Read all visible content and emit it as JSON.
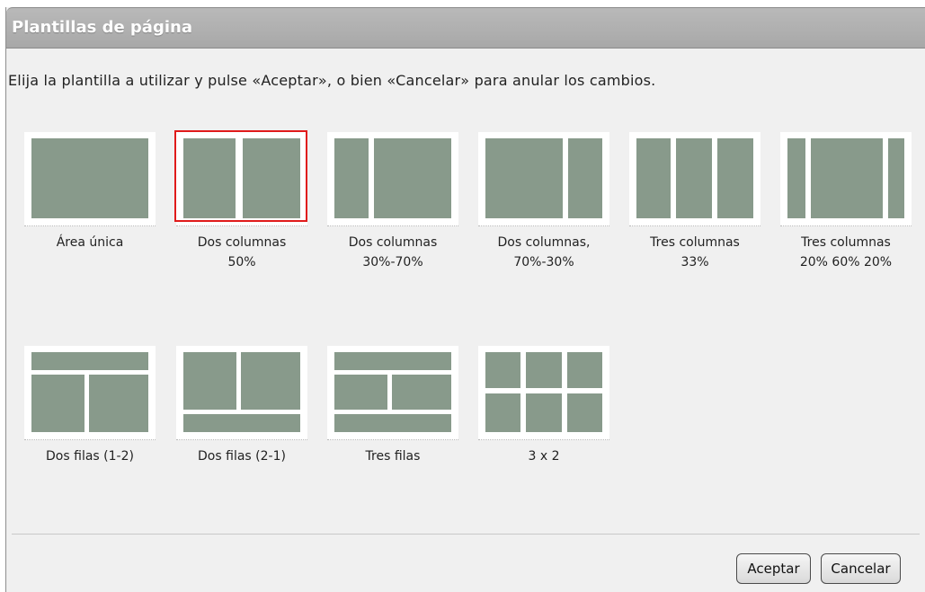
{
  "dialog": {
    "title": "Plantillas de página",
    "instructions": "Elija la plantilla a utilizar y pulse «Aceptar», o bien «Cancelar» para anular los cambios."
  },
  "templates": [
    {
      "id": "area-unica",
      "label": "Área única",
      "selected": false
    },
    {
      "id": "dos-columnas-50",
      "label": "Dos columnas\n50%",
      "selected": true
    },
    {
      "id": "dos-columnas-30-70",
      "label": "Dos columnas\n30%-70%",
      "selected": false
    },
    {
      "id": "dos-columnas-70-30",
      "label": "Dos columnas,\n70%-30%",
      "selected": false
    },
    {
      "id": "tres-columnas-33",
      "label": "Tres columnas\n33%",
      "selected": false
    },
    {
      "id": "tres-columnas-20-60-20",
      "label": "Tres columnas\n20% 60% 20%",
      "selected": false
    },
    {
      "id": "dos-filas-1-2",
      "label": "Dos filas (1-2)",
      "selected": false
    },
    {
      "id": "dos-filas-2-1",
      "label": "Dos filas (2-1)",
      "selected": false
    },
    {
      "id": "tres-filas",
      "label": "Tres filas",
      "selected": false
    },
    {
      "id": "3x2",
      "label": "3 x 2",
      "selected": false
    }
  ],
  "buttons": {
    "accept": "Aceptar",
    "cancel": "Cancelar"
  },
  "colors": {
    "panel": "#889a8b",
    "selection": "#e01b1b"
  }
}
